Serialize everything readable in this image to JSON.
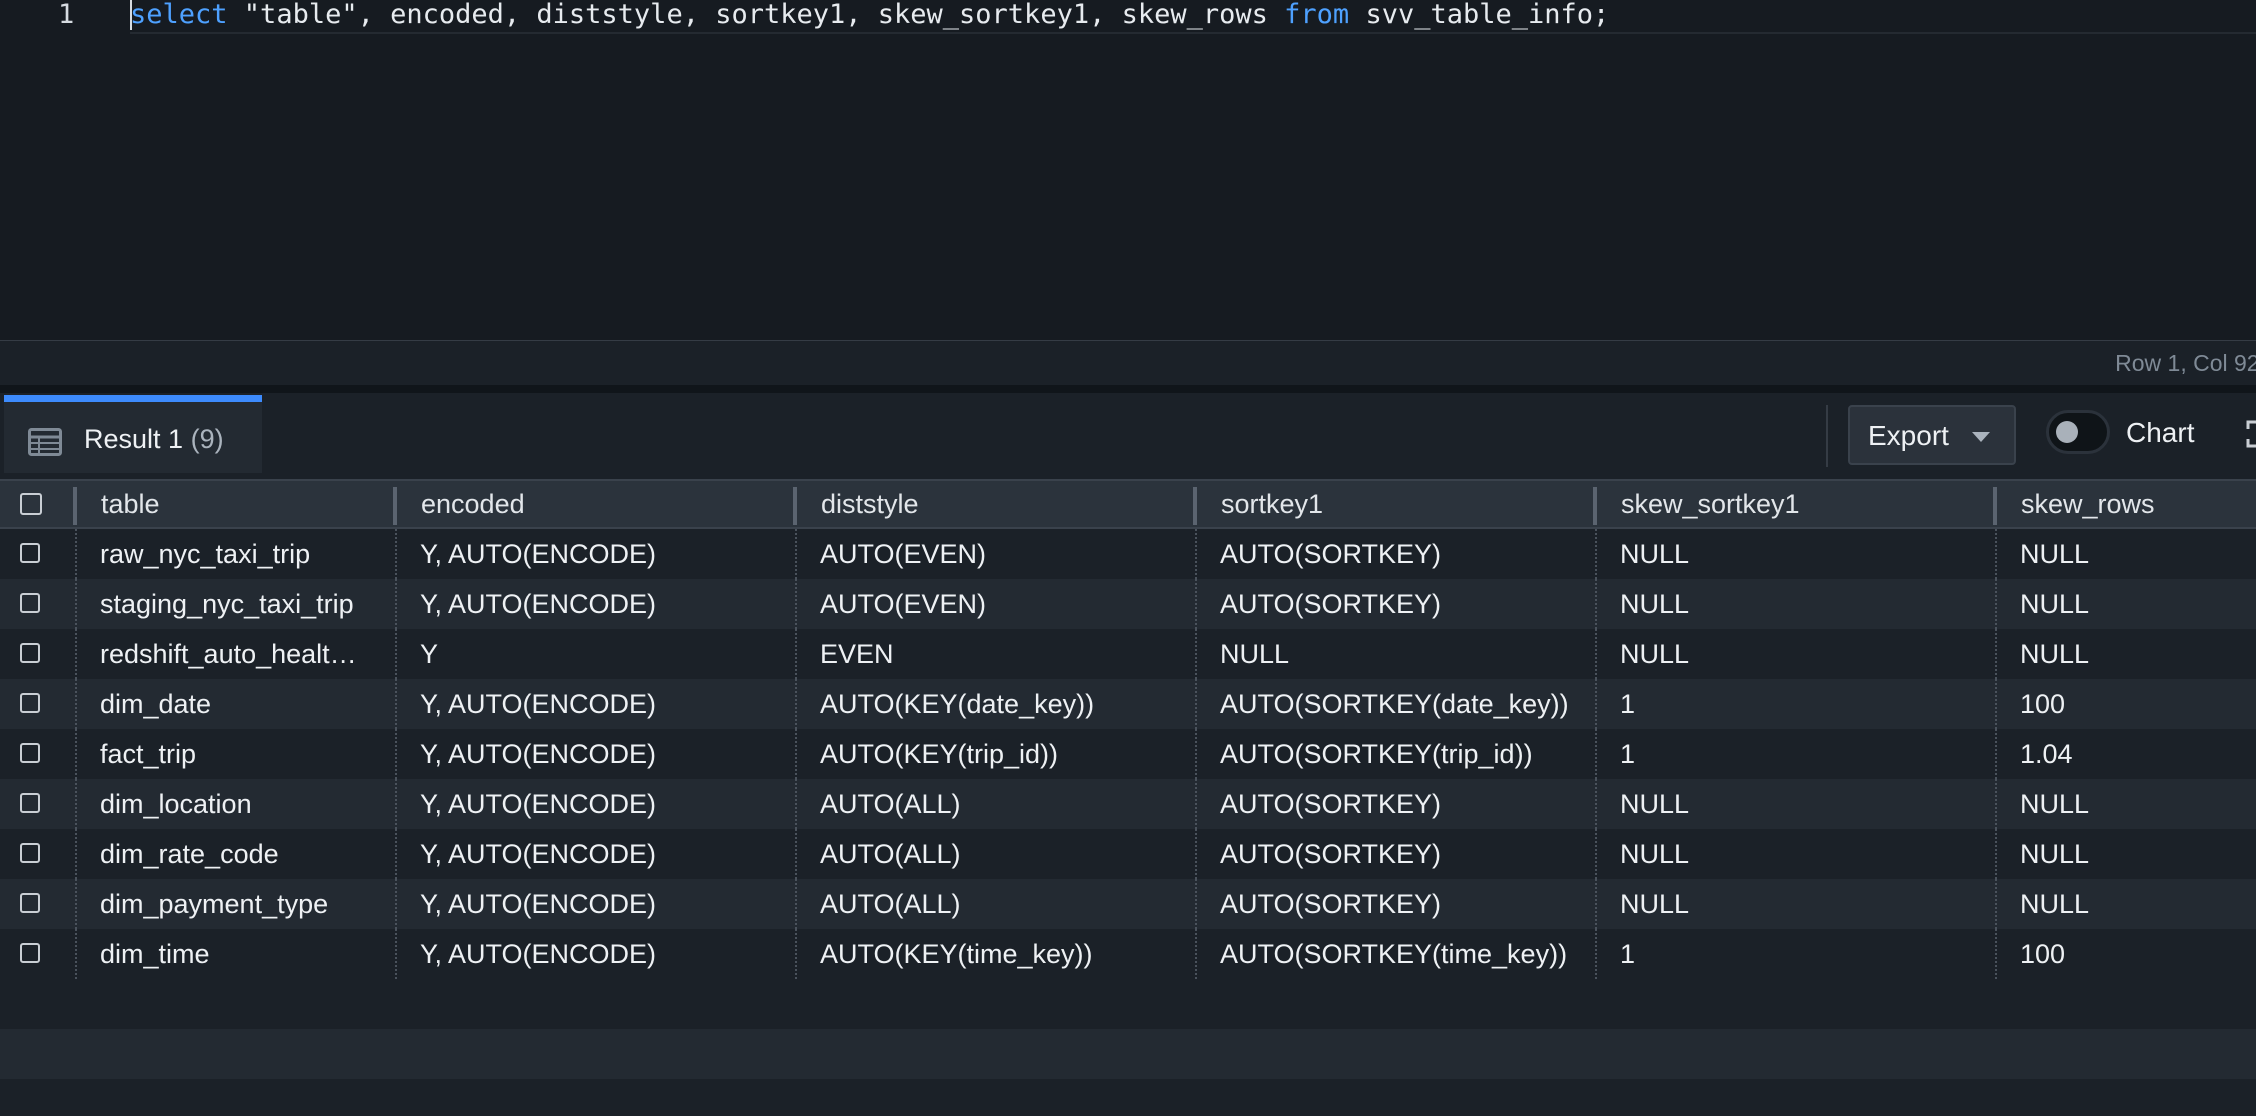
{
  "editor": {
    "line_number": "1",
    "tokens": [
      {
        "text": "select",
        "kw": true
      },
      {
        "text": " \"table\", encoded, diststyle, sortkey1, skew_sortkey1, skew_rows ",
        "kw": false
      },
      {
        "text": "from",
        "kw": true
      },
      {
        "text": " svv_table_info;",
        "kw": false
      }
    ]
  },
  "status": {
    "cursor_position": "Row 1,  Col 92,"
  },
  "result": {
    "tab_label": "Result 1",
    "row_count": "(9)",
    "export_label": "Export",
    "chart_label": "Chart",
    "chart_enabled": false
  },
  "table": {
    "columns": [
      "table",
      "encoded",
      "diststyle",
      "sortkey1",
      "skew_sortkey1",
      "skew_rows"
    ],
    "rows": [
      [
        "raw_nyc_taxi_trip",
        "Y, AUTO(ENCODE)",
        "AUTO(EVEN)",
        "AUTO(SORTKEY)",
        "NULL",
        "NULL"
      ],
      [
        "staging_nyc_taxi_trip",
        "Y, AUTO(ENCODE)",
        "AUTO(EVEN)",
        "AUTO(SORTKEY)",
        "NULL",
        "NULL"
      ],
      [
        "redshift_auto_healt…",
        "Y",
        "EVEN",
        "NULL",
        "NULL",
        "NULL"
      ],
      [
        "dim_date",
        "Y, AUTO(ENCODE)",
        "AUTO(KEY(date_key))",
        "AUTO(SORTKEY(date_key))",
        "1",
        "100"
      ],
      [
        "fact_trip",
        "Y, AUTO(ENCODE)",
        "AUTO(KEY(trip_id))",
        "AUTO(SORTKEY(trip_id))",
        "1",
        "1.04"
      ],
      [
        "dim_location",
        "Y, AUTO(ENCODE)",
        "AUTO(ALL)",
        "AUTO(SORTKEY)",
        "NULL",
        "NULL"
      ],
      [
        "dim_rate_code",
        "Y, AUTO(ENCODE)",
        "AUTO(ALL)",
        "AUTO(SORTKEY)",
        "NULL",
        "NULL"
      ],
      [
        "dim_payment_type",
        "Y, AUTO(ENCODE)",
        "AUTO(ALL)",
        "AUTO(SORTKEY)",
        "NULL",
        "NULL"
      ],
      [
        "dim_time",
        "Y, AUTO(ENCODE)",
        "AUTO(KEY(time_key))",
        "AUTO(SORTKEY(time_key))",
        "1",
        "100"
      ]
    ]
  },
  "icons": {
    "result_tab": "table-icon",
    "export_caret": "caret-down-icon",
    "fullscreen": "fullscreen-icon"
  }
}
